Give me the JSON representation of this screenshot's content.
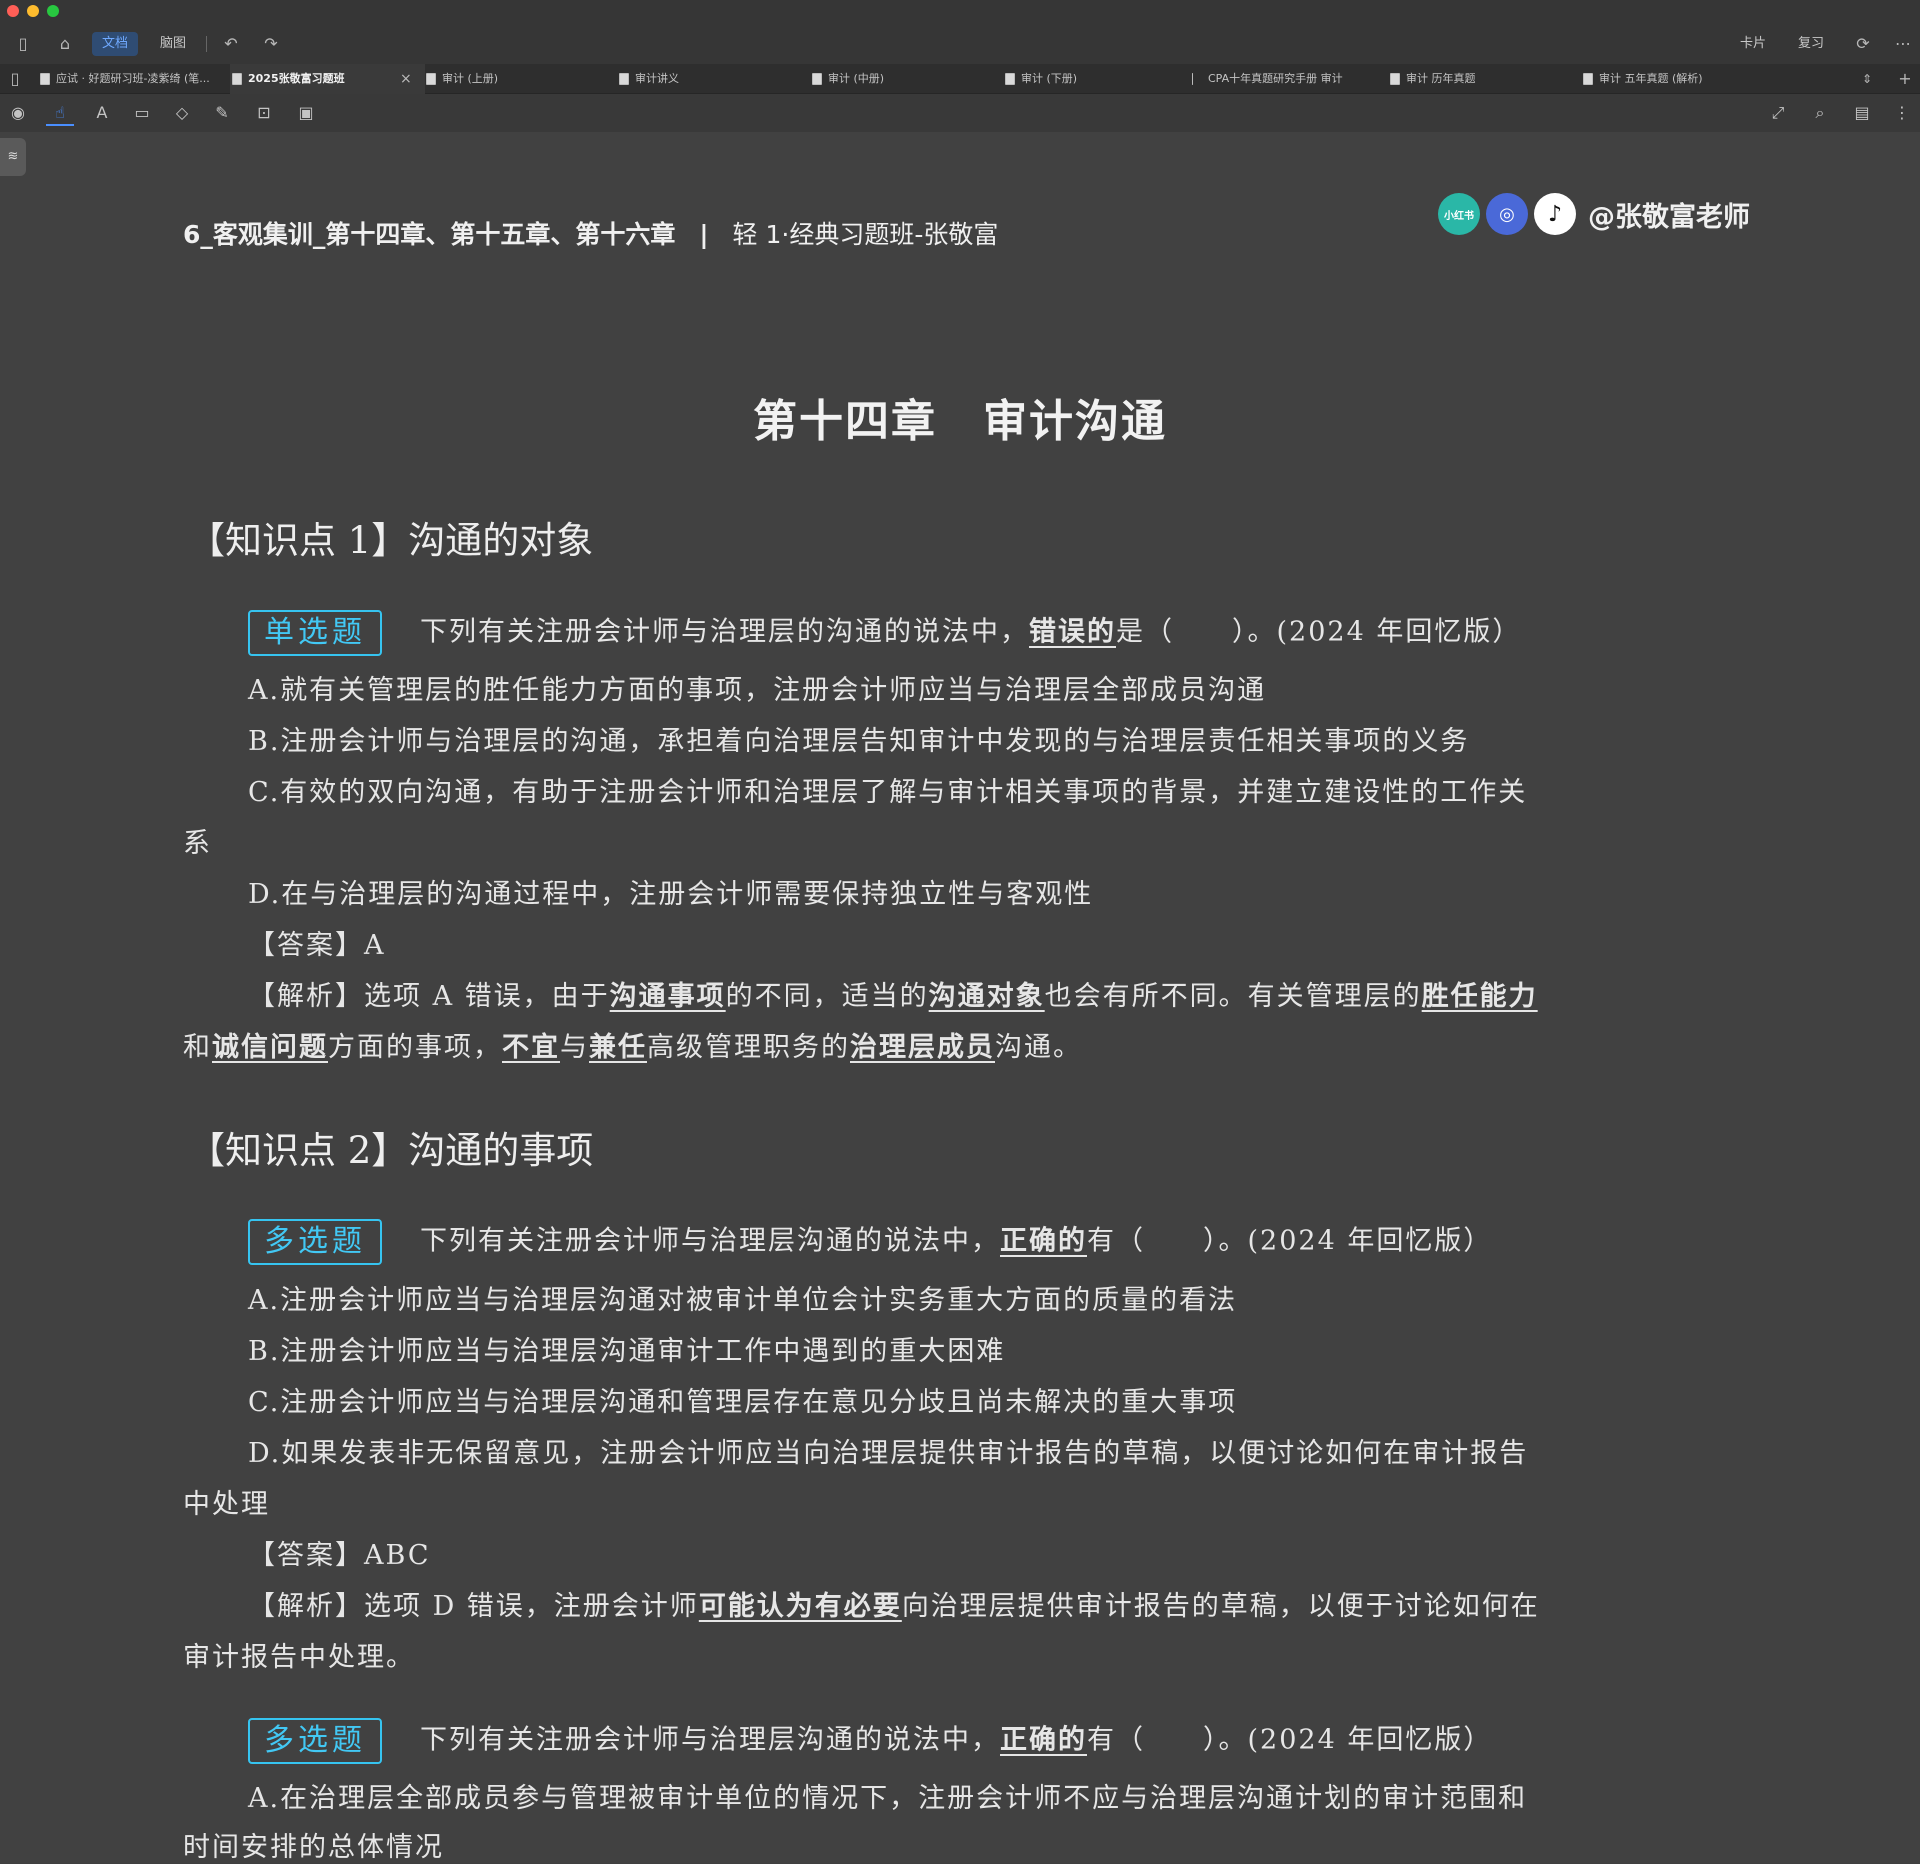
{
  "app": {
    "toolbar": {
      "mode_doc": "文档",
      "mode_mindmap": "脑图",
      "cards": "卡片",
      "review": "复习"
    },
    "tabs": [
      {
        "label": "应试 · 好题研习班-凌紫绮 (笔...",
        "active": false
      },
      {
        "label": "2025张敬富习题班",
        "active": true
      },
      {
        "label": "审计 (上册)",
        "active": false
      },
      {
        "label": "审计讲义",
        "active": false
      },
      {
        "label": "审计 (中册)",
        "active": false
      },
      {
        "label": "审计 (下册)",
        "active": false
      },
      {
        "label": "CPA十年真题研究手册 审计",
        "active": false
      },
      {
        "label": "审计 历年真题",
        "active": false
      },
      {
        "label": "审计 五年真题 (解析)",
        "active": false
      }
    ],
    "tab_close": "×"
  },
  "doc": {
    "header": {
      "title": "6_客观集训_第十四章、第十五章、第十六章",
      "separator": "|",
      "course": "轻 1·经典习题班-张敬富",
      "social_xhs": "小红书",
      "handle": "@张敬富老师"
    },
    "chapter_title": "第十四章　审计沟通",
    "kp1": {
      "title": "【知识点 1】沟通的对象",
      "q1": {
        "badge": "单选题",
        "stem_a": "下列有关注册会计师与治理层的沟通的说法中，",
        "stem_u": "错误的",
        "stem_b": "是（　　）。(2024 年回忆版）",
        "opt_a": "A.就有关管理层的胜任能力方面的事项，注册会计师应当与治理层全部成员沟通",
        "opt_b": "B.注册会计师与治理层的沟通，承担着向治理层告知审计中发现的与治理层责任相关事项的义务",
        "opt_c1": "C.有效的双向沟通，有助于注册会计师和治理层了解与审计相关事项的背景，并建立建设性的工作关",
        "opt_c2": "系",
        "opt_d": "D.在与治理层的沟通过程中，注册会计师需要保持独立性与客观性",
        "answer": "【答案】A",
        "exp_1": "【解析】选项 A 错误，由于",
        "exp_u1": "沟通事项",
        "exp_2": "的不同，适当的",
        "exp_u2": "沟通对象",
        "exp_3": "也会有所不同。有关管理层的",
        "exp_u3": "胜任能力",
        "exp_4": "和",
        "exp_u4": "诚信问题",
        "exp_5": "方面的事项，",
        "exp_u5": "不宜",
        "exp_6": "与",
        "exp_u6": "兼任",
        "exp_7": "高级管理职务的",
        "exp_u7": "治理层成员",
        "exp_8": "沟通。"
      }
    },
    "kp2": {
      "title": "【知识点 2】沟通的事项",
      "q2": {
        "badge": "多选题",
        "stem_a": "下列有关注册会计师与治理层沟通的说法中，",
        "stem_u": "正确的",
        "stem_b": "有（　　）。(2024 年回忆版）",
        "opt_a": "A.注册会计师应当与治理层沟通对被审计单位会计实务重大方面的质量的看法",
        "opt_b": "B.注册会计师应当与治理层沟通审计工作中遇到的重大困难",
        "opt_c": "C.注册会计师应当与治理层沟通和管理层存在意见分歧且尚未解决的重大事项",
        "opt_d1": "D.如果发表非无保留意见，注册会计师应当向治理层提供审计报告的草稿，以便讨论如何在审计报告",
        "opt_d2": "中处理",
        "answer": "【答案】ABC",
        "exp_1": "【解析】选项 D 错误，注册会计师",
        "exp_u1": "可能认为有必要",
        "exp_2": "向治理层提供审计报告的草稿，以便于讨论如何在",
        "exp_3": "审计报告中处理。"
      },
      "q3": {
        "badge": "多选题",
        "stem_a": "下列有关注册会计师与治理层沟通的说法中，",
        "stem_u": "正确的",
        "stem_b": "有（　　）。(2024 年回忆版）",
        "opt_a1": "A.在治理层全部成员参与管理被审计单位的情况下，注册会计师不应与治理层沟通计划的审计范围和",
        "opt_a2": "时间安排的总体情况"
      }
    }
  }
}
